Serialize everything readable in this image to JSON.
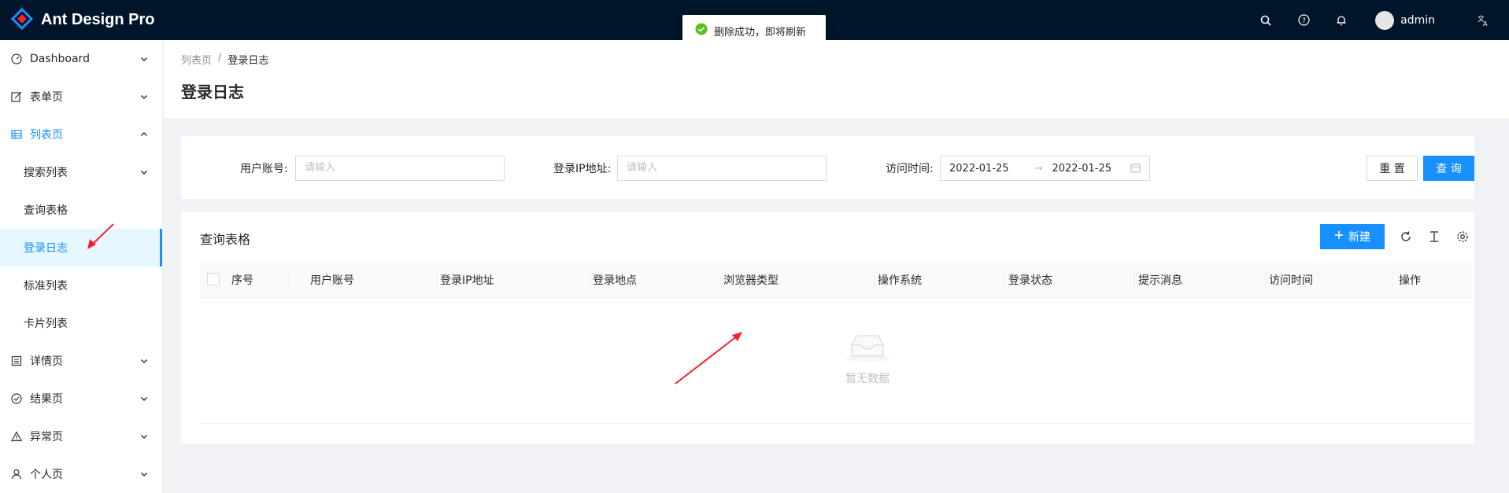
{
  "app": {
    "title": "Ant Design Pro"
  },
  "header": {
    "user_name": "admin",
    "icons": [
      "search-icon",
      "question-icon",
      "bell-icon",
      "translate-icon"
    ]
  },
  "toast": {
    "message": "删除成功，即将刷新",
    "icon": "check-circle-icon"
  },
  "sidebar": {
    "items": [
      {
        "label": "Dashboard",
        "icon": "dashboard-icon"
      },
      {
        "label": "表单页",
        "icon": "form-icon"
      },
      {
        "label": "列表页",
        "icon": "table-icon"
      },
      {
        "label": "搜索列表"
      },
      {
        "label": "查询表格"
      },
      {
        "label": "登录日志"
      },
      {
        "label": "标准列表"
      },
      {
        "label": "卡片列表"
      },
      {
        "label": "详情页",
        "icon": "profile-icon"
      },
      {
        "label": "结果页",
        "icon": "check-circle-icon"
      },
      {
        "label": "异常页",
        "icon": "warning-icon"
      },
      {
        "label": "个人页",
        "icon": "user-icon"
      }
    ]
  },
  "breadcrumb": {
    "parent": "列表页",
    "separator": "/",
    "current": "登录日志"
  },
  "page": {
    "title": "登录日志"
  },
  "search": {
    "user_label": "用户账号:",
    "user_placeholder": "请输入",
    "ip_label": "登录IP地址:",
    "ip_placeholder": "请输入",
    "time_label": "访问时间:",
    "date_from": "2022-01-25",
    "date_to": "2022-01-25",
    "range_separator": "→",
    "reset_label": "重 置",
    "query_label": "查 询"
  },
  "table": {
    "title": "查询表格",
    "new_label": "新建",
    "columns": [
      "序号",
      "用户账号",
      "登录IP地址",
      "登录地点",
      "浏览器类型",
      "操作系统",
      "登录状态",
      "提示消息",
      "访问时间",
      "操作"
    ],
    "empty_text": "暂无数据"
  },
  "colors": {
    "primary": "#1890ff",
    "header_bg": "#001529",
    "success": "#52c41a",
    "annotation_arrow": "#f5222d"
  }
}
